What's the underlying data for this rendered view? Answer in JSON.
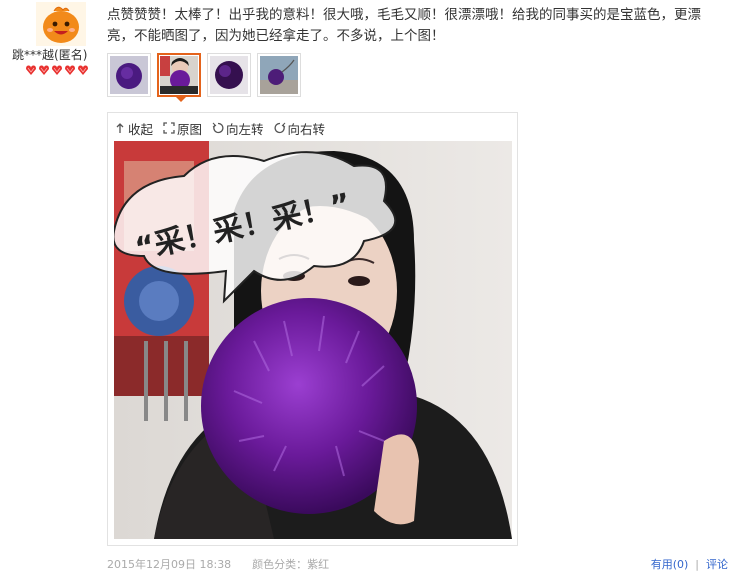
{
  "reviewer": {
    "name": "跳***越",
    "anonymous_tag": "(匿名)",
    "badge_icons": [
      "heart-gem-icon",
      "heart-gem-icon",
      "heart-gem-icon",
      "heart-gem-icon",
      "heart-gem-icon"
    ],
    "badge_color": "#e8312f"
  },
  "review": {
    "text": "点赞赞赞！太棒了！出乎我的意料！很大哦，毛毛又顺！很漂漂哦！给我的同事买的是宝蓝色，更漂亮，不能晒图了，因为她已经拿走了。不多说，上个图！"
  },
  "thumbnails": [
    {
      "name": "thumbnail-1",
      "active": false
    },
    {
      "name": "thumbnail-2",
      "active": true
    },
    {
      "name": "thumbnail-3",
      "active": false
    },
    {
      "name": "thumbnail-4",
      "active": false
    }
  ],
  "toolbar": {
    "collapse_label": "收起",
    "original_label": "原图",
    "rotate_left_label": "向左转",
    "rotate_right_label": "向右转"
  },
  "photo": {
    "sticker_text": "“采！采！采！”"
  },
  "footer": {
    "date": "2015年12月09日 18:38",
    "category": "颜色分类：紫红",
    "useful_label": "有用",
    "useful_count": "(0)",
    "reply_label": "评论"
  },
  "colors": {
    "accent": "#e4631b",
    "fur": "#6a1a9a",
    "link": "#3366cc"
  }
}
